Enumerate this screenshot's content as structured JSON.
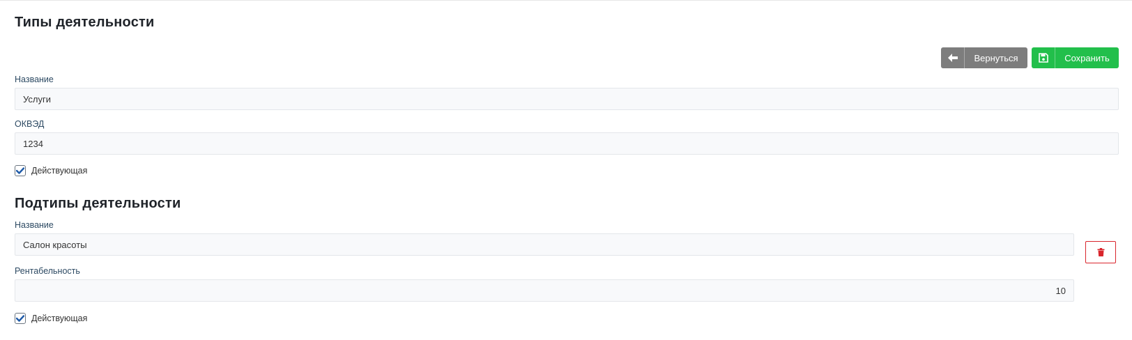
{
  "header": {
    "title": "Типы деятельности"
  },
  "toolbar": {
    "back_label": "Вернуться",
    "save_label": "Сохранить"
  },
  "activity": {
    "name_label": "Название",
    "name_value": "Услуги",
    "okved_label": "ОКВЭД",
    "okved_value": "1234",
    "active_label": "Действующая",
    "active_checked": true
  },
  "subtypes": {
    "title": "Подтипы деятельности",
    "items": [
      {
        "name_label": "Название",
        "name_value": "Салон красоты",
        "profit_label": "Рентабельность",
        "profit_value": "10",
        "active_label": "Действующая",
        "active_checked": true
      }
    ]
  },
  "icons": {
    "back": "arrow-left-icon",
    "save": "floppy-disk-icon",
    "delete": "trash-icon",
    "check": "checkmark-icon"
  },
  "colors": {
    "back_button": "#7d7d7d",
    "save_button": "#22bf4b",
    "delete_border": "#d9252c",
    "checkbox_mark": "#1e5aa8",
    "label": "#2d4a63"
  }
}
